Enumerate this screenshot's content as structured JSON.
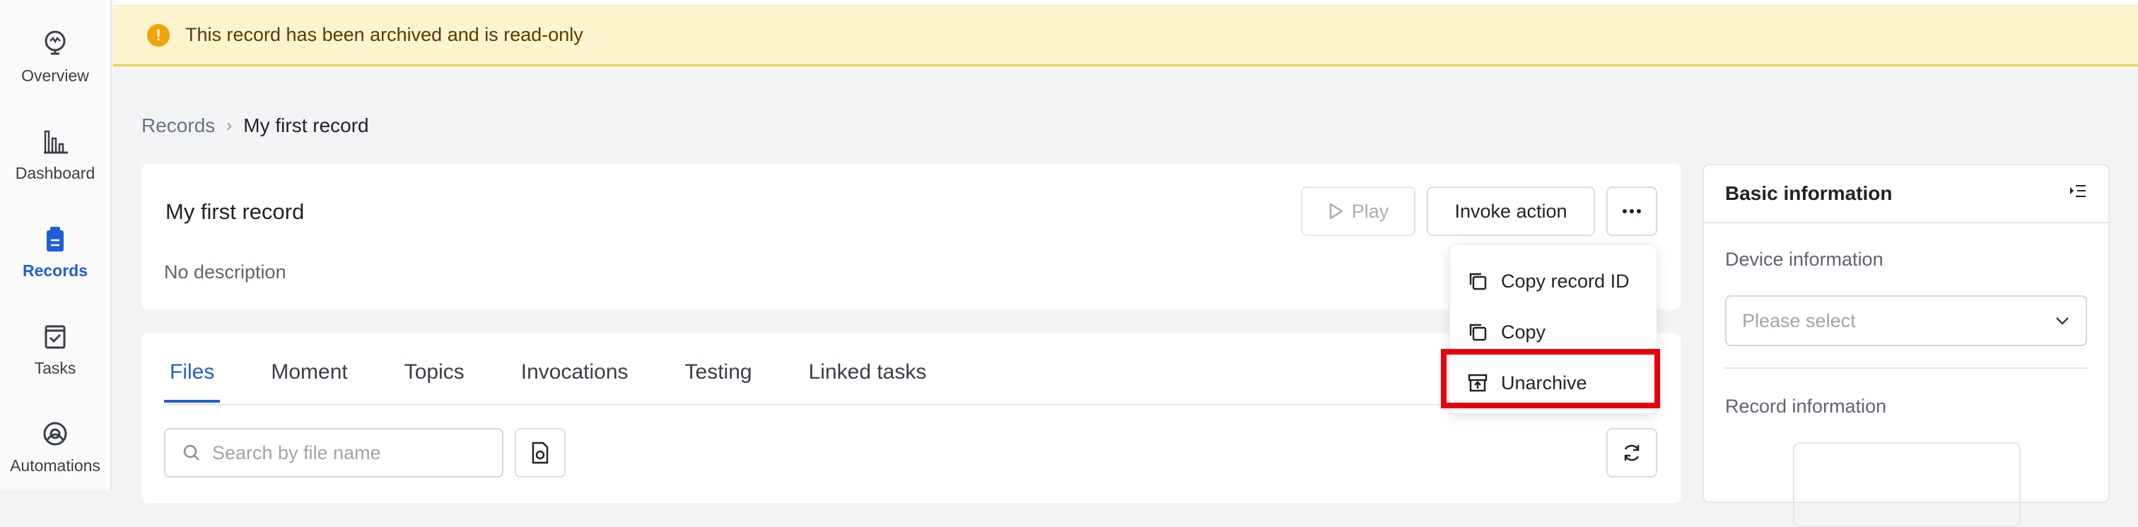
{
  "sidebar": {
    "items": [
      {
        "label": "Overview",
        "icon": "overview-icon",
        "active": false
      },
      {
        "label": "Dashboard",
        "icon": "bar-chart-icon",
        "active": false
      },
      {
        "label": "Records",
        "icon": "records-icon",
        "active": true
      },
      {
        "label": "Tasks",
        "icon": "tasks-icon",
        "active": false
      },
      {
        "label": "Automations",
        "icon": "automations-icon",
        "active": false
      }
    ]
  },
  "banner": {
    "message": "This record has been archived and is read-only",
    "icon": "warning-icon",
    "color": "#fcf4cc"
  },
  "breadcrumb": {
    "root": "Records",
    "current": "My first record"
  },
  "record": {
    "title": "My first record",
    "description": "No description",
    "play_label": "Play",
    "invoke_label": "Invoke action"
  },
  "menu": {
    "items": [
      {
        "label": "Copy record ID",
        "icon": "copy-icon"
      },
      {
        "label": "Copy",
        "icon": "copy-icon"
      },
      {
        "label": "Unarchive",
        "icon": "unarchive-icon"
      }
    ],
    "highlight_color": "#e8000f"
  },
  "tabs": [
    {
      "label": "Files",
      "active": true
    },
    {
      "label": "Moment",
      "active": false
    },
    {
      "label": "Topics",
      "active": false
    },
    {
      "label": "Invocations",
      "active": false
    },
    {
      "label": "Testing",
      "active": false
    },
    {
      "label": "Linked tasks",
      "active": false
    }
  ],
  "files": {
    "search_placeholder": "Search by file name"
  },
  "side_panel": {
    "title": "Basic information",
    "device_label": "Device information",
    "device_placeholder": "Please select",
    "record_info_label": "Record information"
  },
  "colors": {
    "accent": "#1e5fd9",
    "warning": "#f0a30a"
  }
}
